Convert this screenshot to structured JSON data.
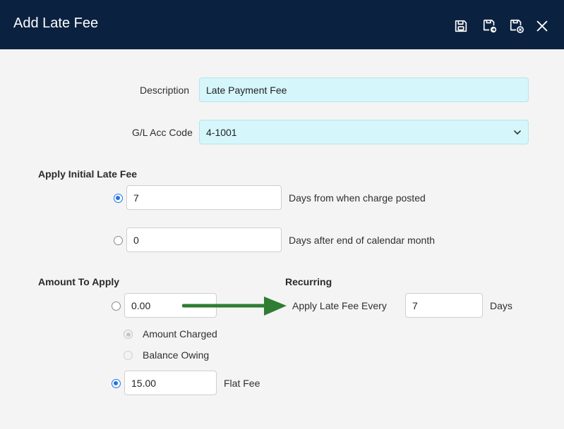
{
  "dialog": {
    "title": "Add Late Fee",
    "actions": [
      {
        "name": "save-icon",
        "tooltip": ""
      },
      {
        "name": "save-and-new-icon",
        "tooltip": ""
      },
      {
        "name": "save-and-close-icon",
        "tooltip": ""
      },
      {
        "name": "close-icon",
        "tooltip": ""
      }
    ]
  },
  "description": {
    "label": "Description",
    "value": "Late Payment Fee"
  },
  "gl_acc_code": {
    "label": "G/L Acc Code",
    "value": "4-1001"
  },
  "initial_fee": {
    "heading": "Apply Initial Late Fee",
    "options": [
      {
        "value": "7",
        "label": "Days from when charge posted",
        "selected": true
      },
      {
        "value": "0",
        "label": "Days after end of calendar month",
        "selected": false
      }
    ]
  },
  "amount": {
    "heading": "Amount To Apply",
    "percent_value": "0.00",
    "percent_selected": false,
    "basis_options": [
      {
        "label": "Amount Charged",
        "selected": true,
        "disabled": true
      },
      {
        "label": "Balance Owing",
        "selected": false,
        "disabled": true
      }
    ],
    "flat_value": "15.00",
    "flat_label": "Flat Fee",
    "flat_selected": true
  },
  "recurring": {
    "heading": "Recurring",
    "every_label": "Apply Late Fee Every",
    "every_value": "7",
    "unit_label": "Days"
  },
  "colors": {
    "header_bg": "#0b2140",
    "required_field_bg": "#d5f6fb",
    "radio_accent": "#1a73e8",
    "arrow": "#2e7d32"
  }
}
